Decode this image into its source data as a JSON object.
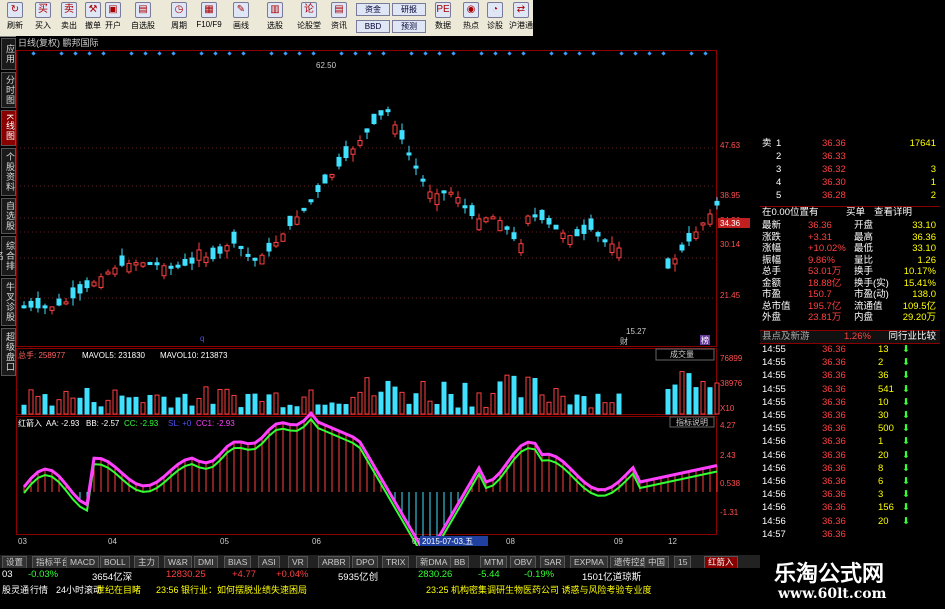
{
  "toolbar": {
    "buttons": [
      {
        "label": "刷新",
        "icon": "refresh-icon",
        "glyph": "↻"
      },
      {
        "label": "买入",
        "icon": "buy-icon",
        "glyph": "买"
      },
      {
        "label": "卖出",
        "icon": "sell-icon",
        "glyph": "卖"
      },
      {
        "label": "撤单",
        "icon": "hammer-icon",
        "glyph": "⚒"
      },
      {
        "label": "开户",
        "icon": "open-account-icon",
        "glyph": "▣"
      },
      {
        "label": "自选股",
        "icon": "watchlist-icon",
        "glyph": "▤"
      },
      {
        "label": "周期",
        "icon": "period-icon",
        "glyph": "◷"
      },
      {
        "label": "F10/F9",
        "icon": "f10-icon",
        "glyph": "▦"
      },
      {
        "label": "画线",
        "icon": "draw-line-icon",
        "glyph": "✎"
      },
      {
        "label": "选股",
        "icon": "select-stock-icon",
        "glyph": "▥"
      },
      {
        "label": "论股堂",
        "icon": "forum-icon",
        "glyph": "论"
      },
      {
        "label": "资讯",
        "icon": "news-icon",
        "glyph": "▤"
      },
      {
        "label": "数据",
        "icon": "data-icon",
        "glyph": "PE"
      },
      {
        "label": "热点",
        "icon": "hotspot-icon",
        "glyph": "◉"
      },
      {
        "label": "诊股",
        "icon": "diagnose-icon",
        "glyph": "◔"
      },
      {
        "label": "沪港通",
        "icon": "hk-connect-icon",
        "glyph": "⇄"
      }
    ],
    "mini_buttons": [
      "资金",
      "BBD",
      "研报",
      "预测"
    ]
  },
  "side_tabs": [
    "应用",
    "分时图",
    "K线图",
    "个股资料",
    "自选股",
    "综合排名",
    "牛叉诊股",
    "超级盘口"
  ],
  "main": {
    "title": "日线(复权)  鹏邦国际",
    "price_labels": [
      "47.63",
      "38.95",
      "34.36",
      "30.14",
      "21.45"
    ],
    "current_price": "34.36",
    "high_label": "62.50",
    "low_label": "15.27",
    "marker_q": "q",
    "marker_cai": "财",
    "marker_bo": "榜",
    "volume_header": {
      "a": "总手: 258977",
      "b": "MAVOL5: 231830",
      "c": "MAVOL10: 213873"
    },
    "volume_scale": [
      "76899",
      "38976",
      "X10"
    ],
    "volume_dropdown": "成交量",
    "indicator_header": {
      "name": "红箭入",
      "aa": "AA: -2.93",
      "bb": "BB: -2.57",
      "cc": "CC: -2.93",
      "sl": "SL: +0",
      "cc1": "CC1: -2.93"
    },
    "indicator_button": "指标说明",
    "indicator_scale": [
      "4.27",
      "2.43",
      "0.538",
      "-1.31"
    ],
    "date_labels": [
      "03",
      "04",
      "05",
      "06",
      "07",
      "08",
      "09",
      "12"
    ],
    "cursor_date": "2015-07-03,五"
  },
  "order_book": [
    {
      "label": "卖",
      "level": "1",
      "price": "36.36",
      "vol": "17641"
    },
    {
      "label": "",
      "level": "2",
      "price": "36.33",
      "vol": ""
    },
    {
      "label": "",
      "level": "3",
      "price": "36.32",
      "vol": "3"
    },
    {
      "label": "",
      "level": "4",
      "price": "36.30",
      "vol": "1"
    },
    {
      "label": "",
      "level": "5",
      "price": "36.28",
      "vol": "2"
    }
  ],
  "position_line": "在0.00位置有",
  "position_buttons": [
    "买单",
    "查看详明"
  ],
  "quote": [
    {
      "k1": "最新",
      "v1": "36.36",
      "k2": "开盘",
      "v2": "33.10"
    },
    {
      "k1": "涨跌",
      "v1": "+3.31",
      "k2": "最高",
      "v2": "36.36"
    },
    {
      "k1": "涨幅",
      "v1": "+10.02%",
      "k2": "最低",
      "v2": "33.10"
    },
    {
      "k1": "振幅",
      "v1": "9.86%",
      "k2": "量比",
      "v2": "1.26"
    },
    {
      "k1": "总手",
      "v1": "53.01万",
      "k2": "换手",
      "v2": "10.17%"
    },
    {
      "k1": "金额",
      "v1": "18.88亿",
      "k2": "换手(实)",
      "v2": "15.41%"
    },
    {
      "k1": "市盈",
      "v1": "150.7",
      "k2": "市盈(动)",
      "v2": "138.0"
    },
    {
      "k1": "总市值",
      "v1": "195.7亿",
      "k2": "流通值",
      "v2": "109.5亿"
    },
    {
      "k1": "外盘",
      "v1": "23.81万",
      "k2": "内盘",
      "v2": "29.20万"
    }
  ],
  "sub_header": {
    "left": "县点及新游",
    "mid": "1.26%",
    "right": "同行业比较"
  },
  "ticks": [
    {
      "t": "14:55",
      "p": "36.36",
      "v": "13"
    },
    {
      "t": "14:55",
      "p": "36.36",
      "v": "2"
    },
    {
      "t": "14:55",
      "p": "36.36",
      "v": "36"
    },
    {
      "t": "14:55",
      "p": "36.36",
      "v": "541"
    },
    {
      "t": "14:55",
      "p": "36.36",
      "v": "10"
    },
    {
      "t": "14:55",
      "p": "36.36",
      "v": "30"
    },
    {
      "t": "14:55",
      "p": "36.36",
      "v": "500"
    },
    {
      "t": "14:56",
      "p": "36.36",
      "v": "1"
    },
    {
      "t": "14:56",
      "p": "36.36",
      "v": "20"
    },
    {
      "t": "14:56",
      "p": "36.36",
      "v": "8"
    },
    {
      "t": "14:56",
      "p": "36.36",
      "v": "6"
    },
    {
      "t": "14:56",
      "p": "36.36",
      "v": "3"
    },
    {
      "t": "14:56",
      "p": "36.36",
      "v": "156"
    },
    {
      "t": "14:56",
      "p": "36.36",
      "v": "20"
    },
    {
      "t": "14:57",
      "p": "36.36",
      "v": ""
    }
  ],
  "bottom_tabs": [
    "设置",
    "指标平台",
    "MACD",
    "BOLL",
    "主力",
    "W&R",
    "DMI",
    "BIAS",
    "ASI",
    "VR",
    "ARBR",
    "DPO",
    "TRIX",
    "新DMA",
    "BB",
    "MTM",
    "OBV",
    "SAR",
    "EXPMA",
    "遗传控盘",
    "中国",
    "15",
    "红箭入"
  ],
  "status1": [
    {
      "text": "03",
      "cls": "wht"
    },
    {
      "text": "-0.03%",
      "cls": "grn"
    },
    {
      "text": "3654亿深",
      "cls": "wht"
    },
    {
      "text": "12830.25",
      "cls": "red"
    },
    {
      "text": "+4.77",
      "cls": "red"
    },
    {
      "text": "+0.04%",
      "cls": "red"
    },
    {
      "text": "5935亿创",
      "cls": "wht"
    },
    {
      "text": "2830.26",
      "cls": "grn"
    },
    {
      "text": "-5.44",
      "cls": "grn"
    },
    {
      "text": "-0.19%",
      "cls": "grn"
    },
    {
      "text": "1501亿道琼斯",
      "cls": "wht"
    }
  ],
  "status2": [
    {
      "text": "股灵通",
      "cls": "wht"
    },
    {
      "text": "行情",
      "cls": "wht"
    },
    {
      "text": "24小时滚动",
      "cls": "wht"
    },
    {
      "text": "世纪在目睹",
      "cls": "yel"
    },
    {
      "text": "23:56 银行业：如何摆脱业绩失速困局",
      "cls": "yel"
    },
    {
      "text": "23:25 机构密集调研生物医药公司 诱惑与风险考验专业度",
      "cls": "yel"
    }
  ],
  "watermark": {
    "title": "乐淘公式网",
    "url": "www.60lt.com"
  }
}
